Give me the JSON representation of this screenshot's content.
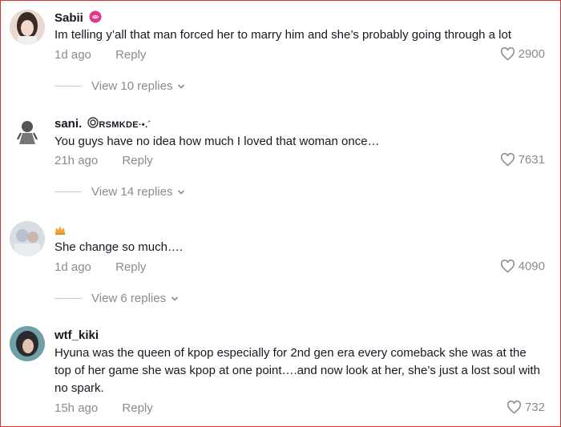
{
  "comments": [
    {
      "username": "Sabii",
      "username_suffix_icon": "lips-kiss-icon",
      "text": "Im telling y’all that man forced her to marry him and she’s probably going through a lot",
      "time": "1d ago",
      "reply_label": "Reply",
      "likes": "2900",
      "view_replies": "View 10 replies"
    },
    {
      "username": "sani.",
      "username_suffix": "RSMKDE·•.´",
      "text": "You guys have no idea how much I loved that woman once…",
      "time": "21h ago",
      "reply_label": "Reply",
      "likes": "7631",
      "view_replies": "View 14 replies"
    },
    {
      "username": "",
      "username_icon": "crown-icon",
      "text": "She change so much….",
      "time": "1d ago",
      "reply_label": "Reply",
      "likes": "4090",
      "view_replies": "View 6 replies"
    },
    {
      "username": "wtf_kiki",
      "text": "Hyuna was the queen of kpop especially for 2nd gen era every comeback she was at the top of her game she was kpop at one point….and now look at her, she’s just a lost soul with no spark.",
      "time": "15h ago",
      "reply_label": "Reply",
      "likes": "732"
    }
  ],
  "colors": {
    "text": "#161823",
    "muted": "#8a8b91",
    "border": "#e03030",
    "lips": "#e0388a",
    "crown": "#f0a33a"
  }
}
